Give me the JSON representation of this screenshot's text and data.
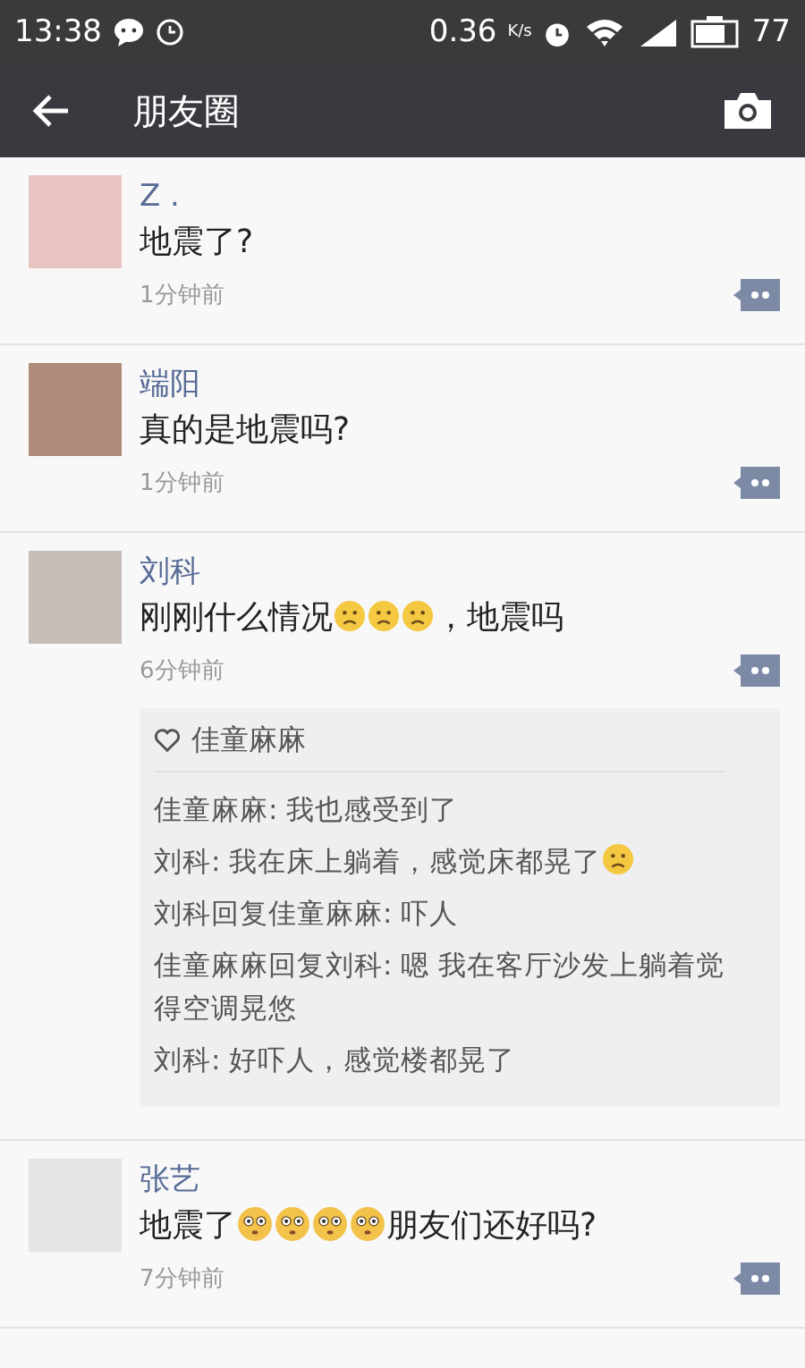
{
  "status_bar": {
    "time": "13:38",
    "speed": "0.36",
    "speed_unit": "K/s",
    "battery": "77"
  },
  "header": {
    "title": "朋友圈"
  },
  "posts": [
    {
      "name": "Z .",
      "segments": [
        {
          "kind": "text",
          "text": "地震了?"
        }
      ],
      "time": "1分钟前"
    },
    {
      "name": "端阳",
      "segments": [
        {
          "kind": "text",
          "text": "真的是地震吗?"
        }
      ],
      "time": "1分钟前"
    },
    {
      "name": "刘科",
      "segments": [
        {
          "kind": "text",
          "text": "刚刚什么情况"
        },
        {
          "kind": "frown"
        },
        {
          "kind": "frown"
        },
        {
          "kind": "frown"
        },
        {
          "kind": "text",
          "text": "，地震吗"
        }
      ],
      "time": "6分钟前",
      "likes": "佳童麻麻",
      "comments": [
        {
          "segments": [
            {
              "kind": "text",
              "text": "佳童麻麻: 我也感受到了"
            }
          ]
        },
        {
          "segments": [
            {
              "kind": "text",
              "text": "刘科: 我在床上躺着，感觉床都晃了"
            },
            {
              "kind": "frown"
            }
          ]
        },
        {
          "segments": [
            {
              "kind": "text",
              "text": "刘科回复佳童麻麻: 吓人"
            }
          ]
        },
        {
          "segments": [
            {
              "kind": "text",
              "text": "佳童麻麻回复刘科: 嗯 我在客厅沙发上躺着觉得空调晃悠"
            }
          ]
        },
        {
          "segments": [
            {
              "kind": "text",
              "text": "刘科: 好吓人，感觉楼都晃了"
            }
          ]
        }
      ]
    },
    {
      "name": "张艺",
      "segments": [
        {
          "kind": "text",
          "text": "地震了"
        },
        {
          "kind": "flushed"
        },
        {
          "kind": "flushed"
        },
        {
          "kind": "flushed"
        },
        {
          "kind": "flushed"
        },
        {
          "kind": "text",
          "text": "朋友们还好吗?"
        }
      ],
      "time": "7分钟前"
    }
  ]
}
